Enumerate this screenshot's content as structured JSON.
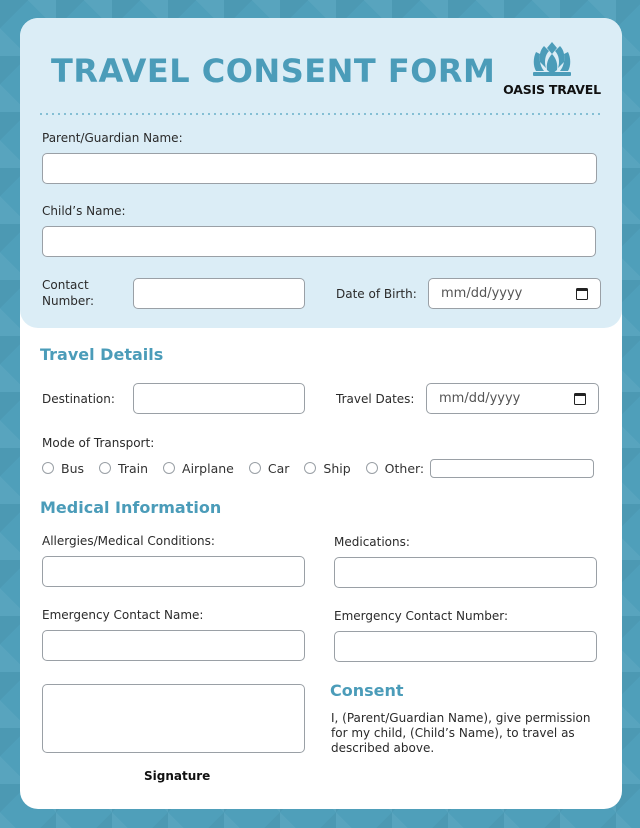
{
  "header": {
    "title": "TRAVEL CONSENT FORM",
    "logo": {
      "icon": "lotus-icon",
      "text": "OASIS TRAVEL"
    }
  },
  "colors": {
    "accent": "#4b9cb9",
    "background": "#4f9fba",
    "header_panel": "#dbedf6",
    "card": "#ffffff"
  },
  "guardian_section": {
    "parent_name": {
      "label": "Parent/Guardian Name:",
      "value": ""
    },
    "child_name": {
      "label": "Child’s Name:",
      "value": ""
    },
    "contact_number": {
      "label_line1": "Contact",
      "label_line2": "Number:",
      "value": ""
    },
    "date_of_birth": {
      "label": "Date of Birth:",
      "placeholder": "mm/dd/yyyy",
      "icon": "calendar-icon"
    }
  },
  "travel_details": {
    "title": "Travel Details",
    "destination": {
      "label": "Destination:",
      "value": ""
    },
    "travel_dates": {
      "label": "Travel Dates:",
      "placeholder": "mm/dd/yyyy",
      "icon": "calendar-icon"
    },
    "mode_of_transport": {
      "label": "Mode of Transport:",
      "options": [
        "Bus",
        "Train",
        "Airplane",
        "Car",
        "Ship",
        "Other:"
      ],
      "selected": null,
      "other_value": ""
    }
  },
  "medical_information": {
    "title": "Medical Information",
    "allergies": {
      "label": "Allergies/Medical Conditions:",
      "value": ""
    },
    "medications": {
      "label": "Medications:",
      "value": ""
    },
    "emergency_contact_name": {
      "label": "Emergency Contact Name:",
      "value": ""
    },
    "emergency_contact_number": {
      "label": "Emergency Contact Number:",
      "value": ""
    }
  },
  "signature": {
    "label": "Signature"
  },
  "consent": {
    "title": "Consent",
    "text": "I, (Parent/Guardian Name), give permission for my child, (Child’s Name), to travel as described above."
  }
}
